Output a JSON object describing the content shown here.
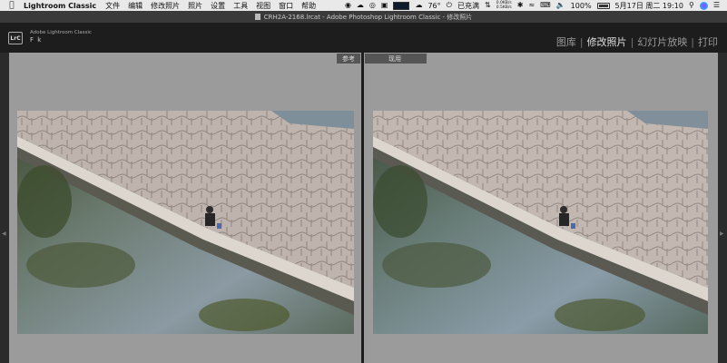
{
  "menubar": {
    "app_name": "Lightroom Classic",
    "items": [
      "文件",
      "编辑",
      "修改照片",
      "照片",
      "设置",
      "工具",
      "视图",
      "窗口",
      "帮助"
    ],
    "status": {
      "temperature": "76°",
      "charge": "已充满",
      "net_up": "0.0KB/s",
      "net_down": "0.5KB/s",
      "battery": "100%",
      "datetime": "5月17日 周二 19:10"
    }
  },
  "window": {
    "title": "CRH2A-2168.lrcat - Adobe Photoshop Lightroom Classic - 修改照片"
  },
  "lr": {
    "logo": "LrC",
    "product": "Adobe Lightroom Classic",
    "identity": "F k",
    "modules": [
      {
        "label": "图库",
        "active": false
      },
      {
        "label": "修改照片",
        "active": true
      },
      {
        "label": "幻灯片放映",
        "active": false
      },
      {
        "label": "打印",
        "active": false
      }
    ]
  },
  "compare": {
    "reference_label": "参考",
    "current_label": "现用"
  },
  "colors": {
    "menubar_bg": "#e9e9e9",
    "lr_topbar_bg": "#1d1d1d",
    "workarea_bg": "#9b9b9b"
  }
}
